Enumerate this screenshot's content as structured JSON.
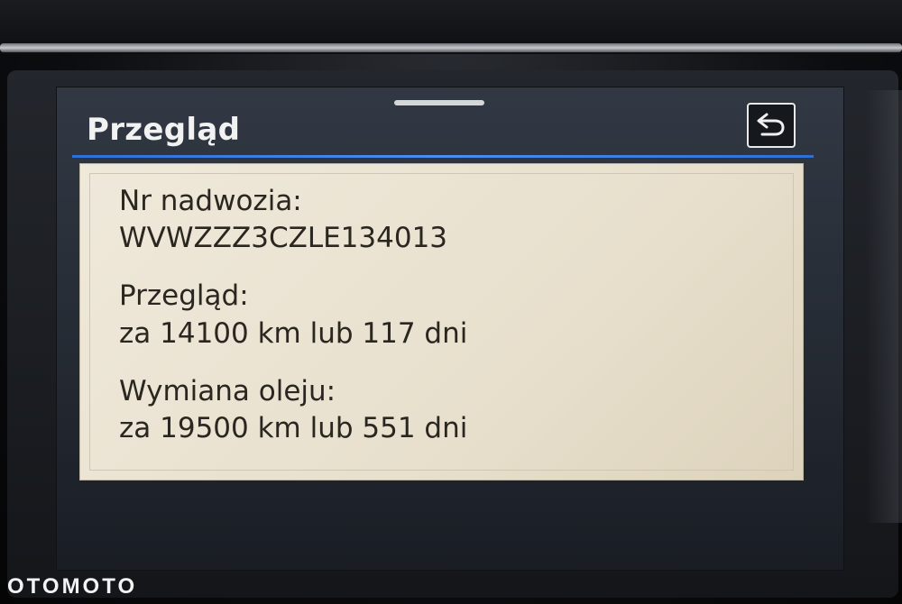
{
  "header": {
    "title": "Przegląd"
  },
  "info": {
    "vin_label": "Nr nadwozia:",
    "vin_value": "WVWZZZ3CZLE134013",
    "service_label": "Przegląd:",
    "service_value": "za 14100 km lub 117 dni",
    "oil_label": "Wymiana oleju:",
    "oil_value": "za 19500 km lub 551 dni"
  },
  "watermark": "OTOMOTO",
  "icons": {
    "back": "back-arrow-icon"
  },
  "colors": {
    "divider": "#3a7ee8",
    "panel_bg": "#ebe4d3",
    "text": "#2a2620"
  }
}
